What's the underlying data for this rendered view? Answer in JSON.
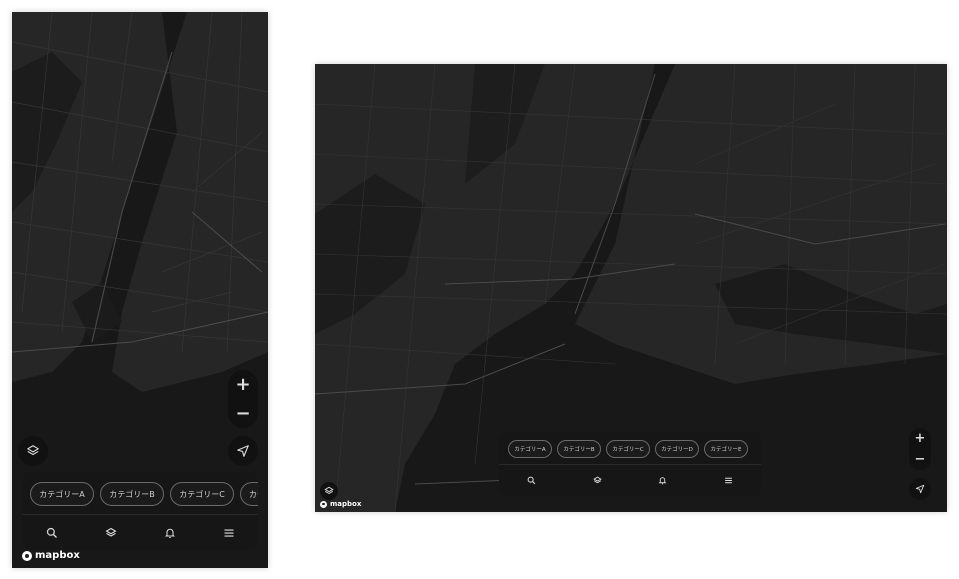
{
  "colors": {
    "map_land": "#262626",
    "map_water": "#161616",
    "road": "#3a3a3a",
    "panel": "#161616",
    "accent": "#ffffff"
  },
  "mobile": {
    "zoom_in": "+",
    "zoom_out": "−",
    "chips": [
      "カテゴリーA",
      "カテゴリーB",
      "カテゴリーC",
      "カテゴリーD"
    ],
    "bottom_icons": [
      "search-icon",
      "layers-icon",
      "bell-icon",
      "menu-icon"
    ],
    "attribution": "mapbox"
  },
  "desktop": {
    "zoom_in": "+",
    "zoom_out": "−",
    "chips": [
      "カテゴリーA",
      "カテゴリーB",
      "カテゴリーC",
      "カテゴリーD",
      "カテゴリーE"
    ],
    "bottom_icons": [
      "search-icon",
      "layers-icon",
      "bell-icon",
      "menu-icon"
    ],
    "attribution": "mapbox"
  }
}
